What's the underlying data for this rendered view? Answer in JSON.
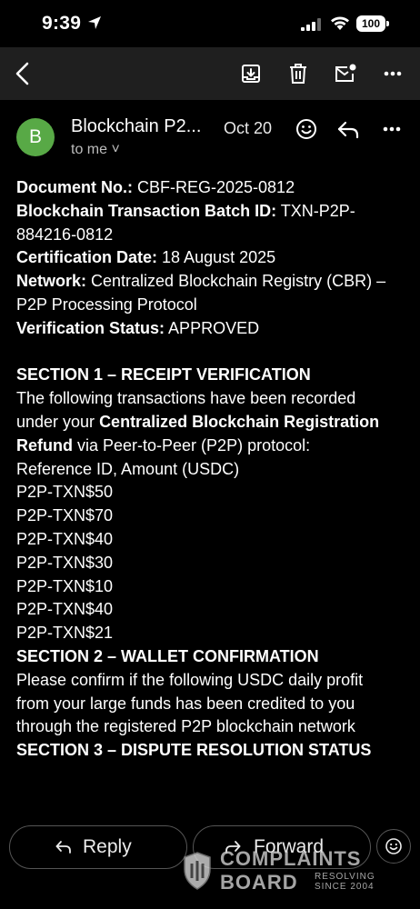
{
  "status_bar": {
    "time": "9:39",
    "battery": "100"
  },
  "toolbar": {
    "icons": [
      "back-icon",
      "archive-icon",
      "trash-icon",
      "mark-unread-icon",
      "more-icon"
    ]
  },
  "email": {
    "avatar_letter": "B",
    "avatar_color": "#58a946",
    "sender": "Blockchain P2...",
    "date": "Oct 20",
    "to": "to me ˅"
  },
  "body": {
    "doc_no_label": "Document No.:",
    "doc_no_value": " CBF-REG-2025-0812",
    "batch_label": "Blockchain Transaction Batch ID:",
    "batch_value": " TXN-P2P-884216-0812",
    "cert_label": "Certification Date:",
    "cert_value": " 18 August 2025",
    "network_label": "Network:",
    "network_value": " Centralized Blockchain Registry (CBR) – P2P Processing Protocol",
    "status_label": "Verification Status:",
    "status_value": " APPROVED",
    "section1_title": "SECTION 1 – RECEIPT VERIFICATION",
    "section1_text_a": "The following transactions have been recorded under your ",
    "section1_bold": "Centralized Blockchain Registration Refund",
    "section1_text_b": " via Peer-to-Peer (P2P) protocol:",
    "table_header": "Reference ID, Amount (USDC)",
    "transactions": [
      "P2P-TXN$50",
      "P2P-TXN$70",
      "P2P-TXN$40",
      "P2P-TXN$30",
      "P2P-TXN$10",
      "P2P-TXN$40",
      "P2P-TXN$21"
    ],
    "section2_title": "SECTION 2 – WALLET CONFIRMATION",
    "section2_text": "Please confirm if the following USDC daily profit from your large funds has been credited to you through the registered P2P blockchain network",
    "section3_title": "SECTION 3 – DISPUTE RESOLUTION STATUS"
  },
  "actions": {
    "reply_label": "Reply",
    "forward_label": "Forward"
  },
  "watermark": {
    "line1": "COMPLAINTS",
    "line2": "BOARD",
    "tag1": "RESOLVING",
    "tag2": "SINCE 2004"
  }
}
